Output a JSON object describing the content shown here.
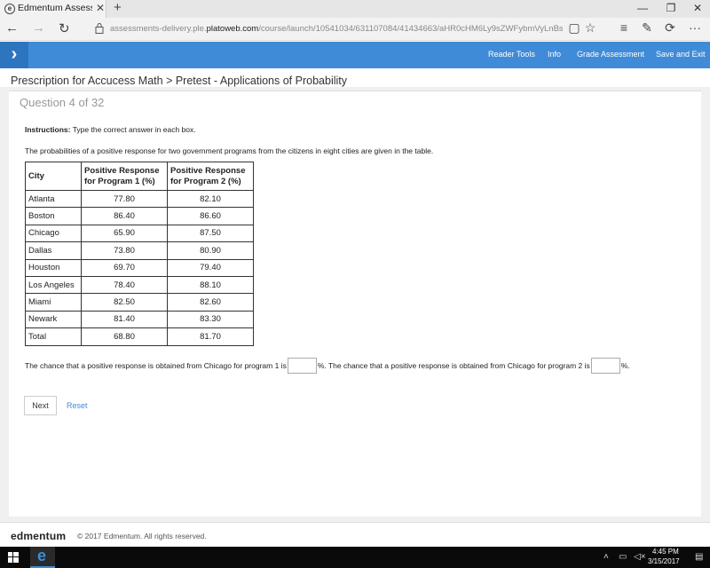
{
  "browser": {
    "tab_title": "Edmentum Assessment:",
    "url_prefix": "assessments-delivery.ple.",
    "url_domain": "platoweb.com",
    "url_path": "/course/launch/10541034/631107084/41434663/aHR0cHM6Ly9sZWFybmVyLnBsZS5wbGF0b3dlYi5jb20v"
  },
  "appbar": {
    "items": [
      "Reader Tools",
      "Info",
      "Grade Assessment",
      "Save and Exit"
    ]
  },
  "breadcrumb": "Prescription for Accucess Math > Pretest - Applications of Probability",
  "question_header": "Question 4 of 32",
  "instructions_label": "Instructions:",
  "instructions_text": " Type the correct answer in each box.",
  "prompt": "The probabilities of a positive response for two government programs from the citizens in eight cities are given in the table.",
  "table": {
    "headers": [
      "City",
      "Positive Response for Program 1 (%)",
      "Positive Response for Program 2 (%)"
    ],
    "rows": [
      [
        "Atlanta",
        "77.80",
        "82.10"
      ],
      [
        "Boston",
        "86.40",
        "86.60"
      ],
      [
        "Chicago",
        "65.90",
        "87.50"
      ],
      [
        "Dallas",
        "73.80",
        "80.90"
      ],
      [
        "Houston",
        "69.70",
        "79.40"
      ],
      [
        "Los Angeles",
        "78.40",
        "88.10"
      ],
      [
        "Miami",
        "82.50",
        "82.60"
      ],
      [
        "Newark",
        "81.40",
        "83.30"
      ],
      [
        "Total",
        "68.80",
        "81.70"
      ]
    ]
  },
  "sentence": {
    "part1": "The chance that a positive response is obtained from Chicago for program 1 is",
    "part2": "%. The chance that a positive response is obtained from Chicago for program 2 is",
    "part3": "%."
  },
  "buttons": {
    "next": "Next",
    "reset": "Reset"
  },
  "footer": {
    "logo": "edmentum",
    "copyright": "© 2017 Edmentum. All rights reserved."
  },
  "taskbar": {
    "time": "4:45 PM",
    "date": "3/15/2017"
  }
}
